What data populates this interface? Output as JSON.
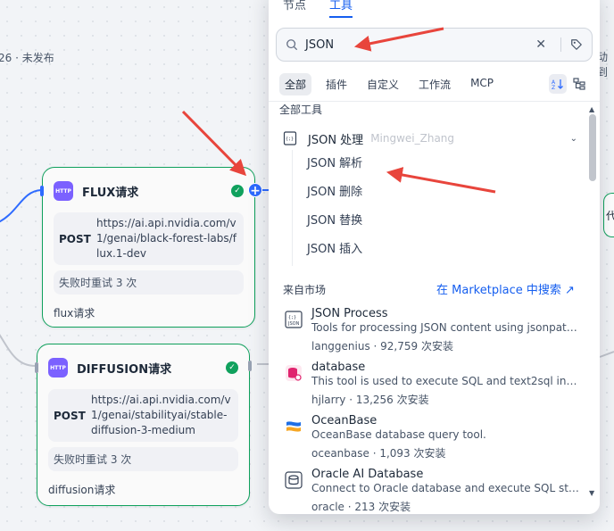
{
  "canvas": {
    "status": "26 · 未发布",
    "edge_right_label": "动到",
    "edge_card_text": "代"
  },
  "nodes": [
    {
      "title": "FLUX请求",
      "badge": "HTTP",
      "method": "POST",
      "url": "https://ai.api.nvidia.com/v1/genai/black-forest-labs/flux.1-dev",
      "retry": "失败时重试 3 次",
      "desc": "flux请求"
    },
    {
      "title": "DIFFUSION请求",
      "badge": "HTTP",
      "method": "POST",
      "url": "https://ai.api.nvidia.com/v1/genai/stabilityai/stable-diffusion-3-medium",
      "retry": "失败时重试 3 次",
      "desc": "diffusion请求"
    }
  ],
  "panel": {
    "tabs": [
      "节点",
      "工具"
    ],
    "active_tab": "工具",
    "search": {
      "value": "JSON"
    },
    "filters": [
      "全部",
      "插件",
      "自定义",
      "工作流",
      "MCP"
    ],
    "active_filter": "全部",
    "all_tools_label": "全部工具",
    "group": {
      "name": "JSON 处理",
      "author": "Mingwei_Zhang"
    },
    "sub_items": [
      "JSON 解析",
      "JSON 删除",
      "JSON 替换",
      "JSON 插入"
    ],
    "market_label": "来自市场",
    "market_link": "在 Marketplace 中搜索 ↗",
    "market_items": [
      {
        "name": "JSON Process",
        "desc": "Tools for processing JSON content using jsonpath...",
        "meta": "langgenius · 92,759 次安装",
        "icon": "json-icon"
      },
      {
        "name": "database",
        "desc": "This tool is used to execute SQL and text2sql in an...",
        "meta": "hjlarry · 13,256 次安装",
        "icon": "database-icon"
      },
      {
        "name": "OceanBase",
        "desc": "OceanBase database query tool.",
        "meta": "oceanbase · 1,093 次安装",
        "icon": "oceanbase-icon"
      },
      {
        "name": "Oracle AI Database",
        "desc": "Connect to Oracle database and execute SQL stat...",
        "meta": "oracle · 213 次安装",
        "icon": "oracle-icon"
      }
    ]
  },
  "colors": {
    "accent": "#155eef",
    "node_border": "#10a15d",
    "http_badge": "#7b61ff",
    "arrow": "#e8453c"
  }
}
